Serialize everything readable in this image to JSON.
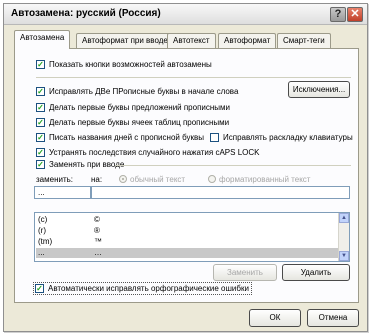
{
  "window": {
    "title": "Автозамена: русский (Россия)",
    "help_label": "?",
    "close_label": "✕"
  },
  "tabs": [
    {
      "label": "Автозамена",
      "active": true
    },
    {
      "label": "Автоформат при вводе",
      "active": false
    },
    {
      "label": "Автотекст",
      "active": false
    },
    {
      "label": "Автоформат",
      "active": false
    },
    {
      "label": "Смарт-теги",
      "active": false
    }
  ],
  "options": {
    "show_buttons": {
      "label": "Показать кнопки возможностей автозамены",
      "checked": true
    },
    "two_initial_caps": {
      "label": "Исправлять ДВе ПРописные буквы в начале слова",
      "checked": true
    },
    "capitalize_sentences": {
      "label": "Делать первые буквы предложений прописными",
      "checked": true
    },
    "capitalize_table_cells": {
      "label": "Делать первые буквы ячеек таблиц прописными",
      "checked": true
    },
    "capitalize_days": {
      "label": "Писать названия дней с прописной буквы",
      "checked": true
    },
    "fix_keyboard_layout": {
      "label": "Исправлять раскладку клавиатуры",
      "checked": false
    },
    "caps_lock": {
      "label": "Устранять последствия случайного нажатия cAPS LOCK",
      "checked": true
    },
    "replace_as_you_type": {
      "label": "Заменять при вводе",
      "checked": true
    },
    "spelling": {
      "label": "Автоматически исправлять орфографические ошибки",
      "checked": true
    }
  },
  "exceptions_button": "Исключения...",
  "replace_section": {
    "replace_label": "заменить:",
    "with_label": "на:",
    "plain_text_label": "обычный текст",
    "formatted_text_label": "форматированный текст",
    "replace_value": "...",
    "with_value": ""
  },
  "entries": [
    {
      "replace": "(c)",
      "with": "©"
    },
    {
      "replace": "(r)",
      "with": "®"
    },
    {
      "replace": "(tm)",
      "with": "™"
    },
    {
      "replace": "...",
      "with": "…"
    }
  ],
  "buttons": {
    "replace": "Заменить",
    "delete": "Удалить",
    "ok": "ОК",
    "cancel": "Отмена"
  },
  "colors": {
    "dialog_bg": "#ece9d8",
    "check_mark": "#21a121",
    "selection": "#c8c8c8"
  },
  "icons": {
    "check": "check-mark-icon",
    "scroll_up": "scroll-up-arrow-icon",
    "scroll_down": "scroll-down-arrow-icon"
  }
}
